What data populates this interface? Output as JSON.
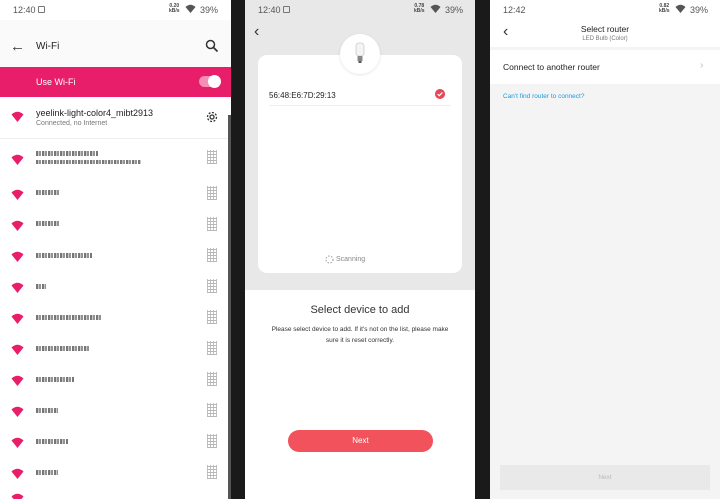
{
  "screen1": {
    "status": {
      "time": "12:40",
      "net_speed": "0.20",
      "net_unit": "kB/s",
      "battery": "39%"
    },
    "title": "Wi-Fi",
    "use_wifi_label": "Use Wi-Fi",
    "connected": {
      "name": "yeelink-light-color4_mibt2913",
      "status": "Connected, no Internet"
    }
  },
  "screen2": {
    "status": {
      "time": "12:40",
      "net_speed": "0.78",
      "net_unit": "kB/s",
      "battery": "39%"
    },
    "device_mac": "56:48:E6:7D:29:13",
    "scanning": "Scanning",
    "title": "Select device to add",
    "description": "Please select device to add. If it's not on the list, please make sure it is reset correctly.",
    "next": "Next"
  },
  "screen3": {
    "status": {
      "time": "12:42",
      "net_speed": "0.82",
      "net_unit": "kB/s",
      "battery": "39%"
    },
    "title": "Select router",
    "subtitle": "LED Bulb (Color)",
    "connect_other": "Connect to another router",
    "cant_find": "Can't find router to connect?",
    "next": "Next"
  },
  "colors": {
    "accent_pink": "#e81e6a",
    "button_red": "#f2525b",
    "link_blue": "#1b9ae0",
    "check_red": "#e8475a"
  }
}
